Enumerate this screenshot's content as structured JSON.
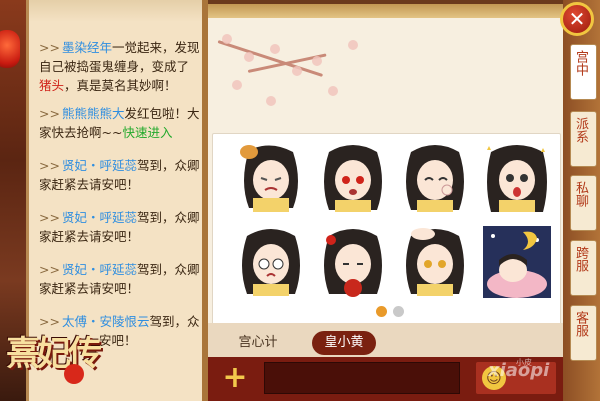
{
  "chat": {
    "messages": [
      {
        "arrows": ">>",
        "name": "墨染经年",
        "part1": "一觉起来，发现自己被捣蛋鬼缠身，变成了",
        "highlight": "猪头",
        "part2": "，真是莫名其妙啊！"
      },
      {
        "arrows": ">>",
        "name": "熊熊熊熊大",
        "part1": "发红包啦！大家快去抢啊~~",
        "link": "快速进入"
      },
      {
        "arrows": ">>",
        "name": "贤妃・呼延蕊",
        "part1": "驾到，众卿家赶紧去请安吧！"
      },
      {
        "arrows": ">>",
        "name": "贤妃・呼延蕊",
        "part1": "驾到，众卿家赶紧去请安吧！"
      },
      {
        "arrows": ">>",
        "name": "贤妃・呼延蕊",
        "part1": "驾到，众卿家赶紧去请安吧！"
      },
      {
        "arrows": ">>",
        "name": "太傅・安陵恨云",
        "part1": "驾到，众",
        "part2": "安吧！"
      }
    ]
  },
  "logo": {
    "text": "熹妃传"
  },
  "side_tabs": {
    "close": "✕",
    "palace": "宫中",
    "faction": "派系",
    "private": "私聊",
    "cross_server": "跨服",
    "service": "客服"
  },
  "sticker_tabs": {
    "tab1": "宫心计",
    "tab2": "皇小黄"
  },
  "input": {
    "add": "+",
    "emoji": "☺"
  },
  "watermark": {
    "main": "xiaopi",
    "small": "小皮"
  },
  "colors": {
    "accent": "#7a2110",
    "name_blue": "#2f8ee0",
    "gold": "#f1c640"
  }
}
